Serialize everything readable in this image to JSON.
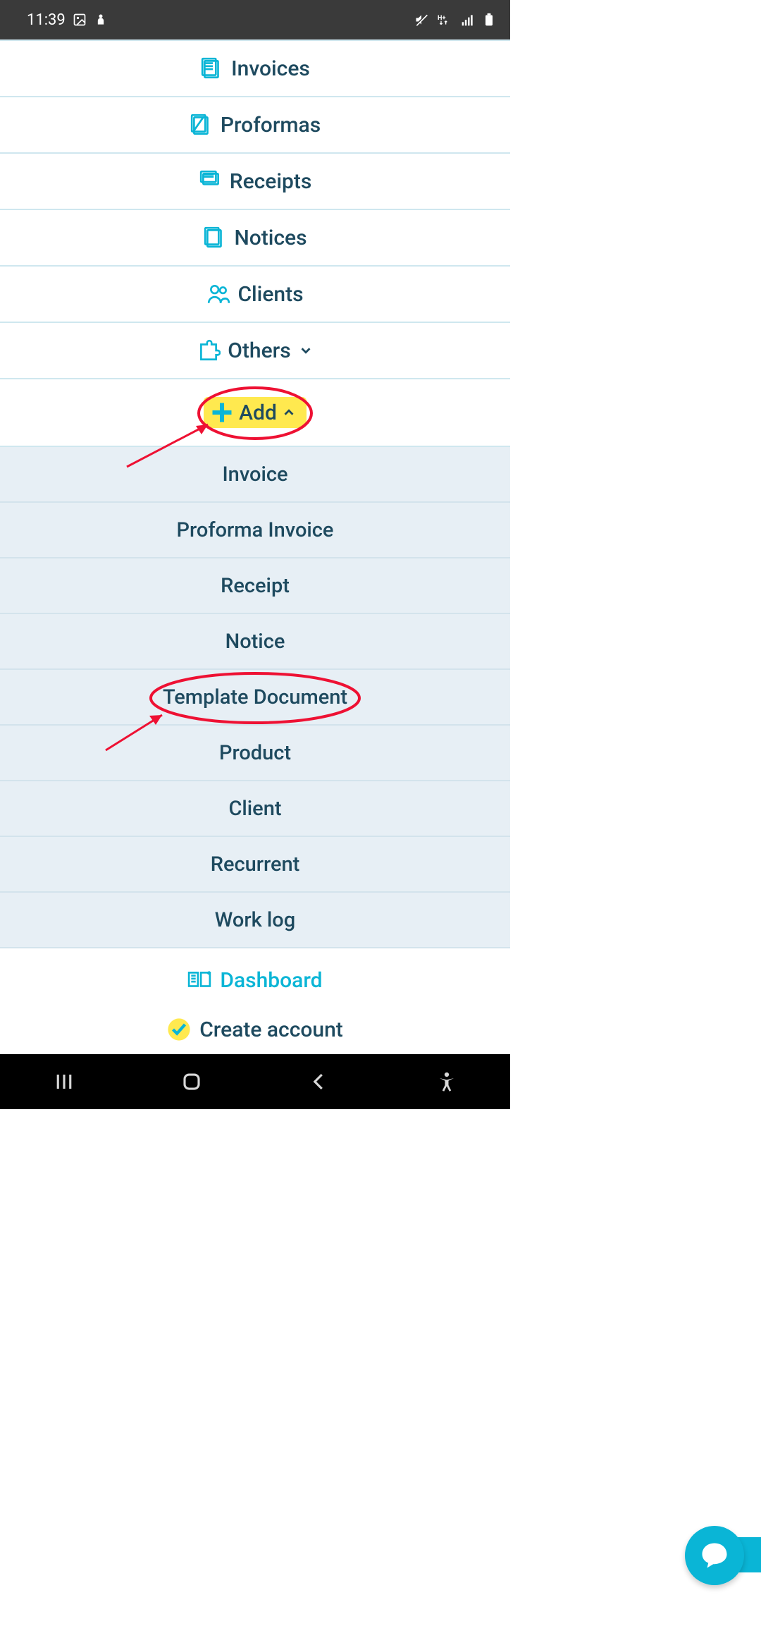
{
  "status": {
    "time": "11:39"
  },
  "nav": {
    "invoices": "Invoices",
    "proformas": "Proformas",
    "receipts": "Receipts",
    "notices": "Notices",
    "clients": "Clients",
    "others": "Others",
    "add": "Add"
  },
  "add_menu": {
    "invoice": "Invoice",
    "proforma": "Proforma Invoice",
    "receipt": "Receipt",
    "notice": "Notice",
    "template": "Template Document",
    "product": "Product",
    "client": "Client",
    "recurrent": "Recurrent",
    "worklog": "Work log"
  },
  "footer": {
    "dashboard": "Dashboard",
    "create": "Create account"
  },
  "colors": {
    "accent": "#0ab5d6",
    "highlight": "#ffe94f",
    "annotation": "#ee1133"
  }
}
